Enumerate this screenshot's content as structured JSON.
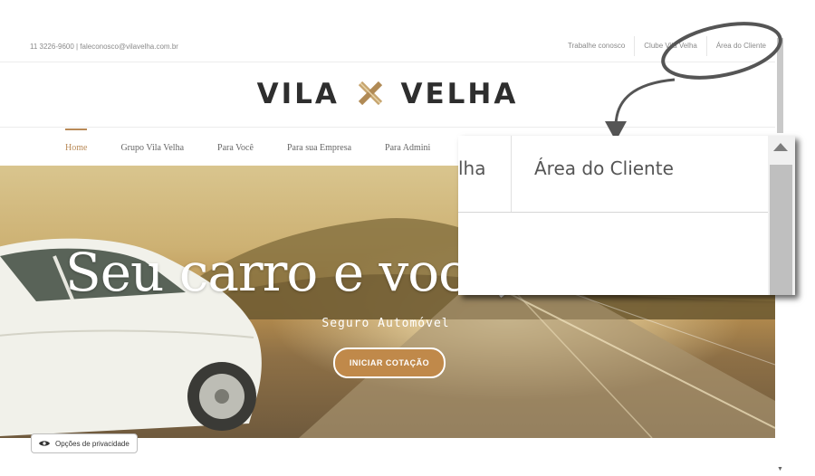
{
  "topbar": {
    "contact": "11 3226-9600  |  faleconosco@vilavelha.com.br",
    "links": [
      "Trabalhe conosco",
      "Clube Vila Velha",
      "Área do Cliente"
    ]
  },
  "logo": {
    "left": "VILA",
    "right": "VELHA"
  },
  "nav": {
    "items": [
      "Home",
      "Grupo Vila Velha",
      "Para Você",
      "Para sua Empresa",
      "Para Admini"
    ]
  },
  "hero": {
    "title": "Seu carro e você,",
    "subtitle": "Seguro Automóvel",
    "cta": "INICIAR COTAÇÃO"
  },
  "privacy": {
    "label": "Opções de privacidade"
  },
  "zoom": {
    "fragment": "lha",
    "label": "Área do Cliente"
  },
  "colors": {
    "accent": "#b98a57",
    "cta_bg": "#c0894a",
    "annotation": "#555555"
  }
}
